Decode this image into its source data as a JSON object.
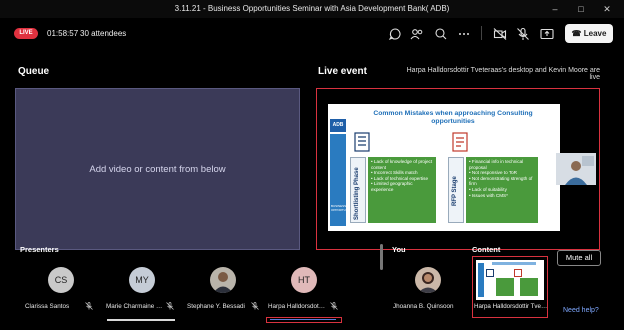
{
  "window": {
    "title": "3.11.21 - Business Opportunities Seminar with Asia Development Bank( ADB)"
  },
  "toolbar": {
    "live_badge": "LIVE",
    "timer": "01:58:57",
    "attendees": "30 attendees",
    "leave_label": "Leave"
  },
  "queue": {
    "title": "Queue",
    "hint": "Add video or content from below"
  },
  "live_event": {
    "title": "Live event",
    "status": "Harpa Halldorsdottir Tveteraas's desktop and Kevin Moore are live",
    "slide": {
      "logo": "ADB",
      "title": "Common Mistakes when approaching Consulting opportunities",
      "left_phase": "Shortlisting Phase",
      "left_items": [
        "Lack of knowledge of project content",
        "Incorrect Skills match",
        "Lack of technical expertise",
        "Limited geographic experience"
      ],
      "right_phase": "RFP Stage",
      "right_items": [
        "Financial info in technical proposal",
        "Not responsive to ToR",
        "Not demonstrating strength of firm",
        "Lack of suitability",
        "Issues with CMS*"
      ],
      "sidebar_text": "BUSINESS OPPORTUNITIES"
    }
  },
  "presenters": {
    "title": "Presenters",
    "people": [
      {
        "initials": "CS",
        "name": "Clarissa Santos",
        "color": "#c9c9c9"
      },
      {
        "initials": "MY",
        "name": "Marie Charmaine Si...",
        "color": "#c5ccd6"
      },
      {
        "initials": "",
        "name": "Stephane Y. Bessadi",
        "color": ""
      },
      {
        "initials": "HT",
        "name": "Harpa Halldorsdotti...",
        "color": "#e0b9b9"
      }
    ]
  },
  "you": {
    "title": "You",
    "name": "Jhoanna B. Quinsoon"
  },
  "content": {
    "title": "Content",
    "name": "Harpa Halldorsdottir Tvete...",
    "mute_all_label": "Mute all",
    "need_help": "Need help?"
  }
}
